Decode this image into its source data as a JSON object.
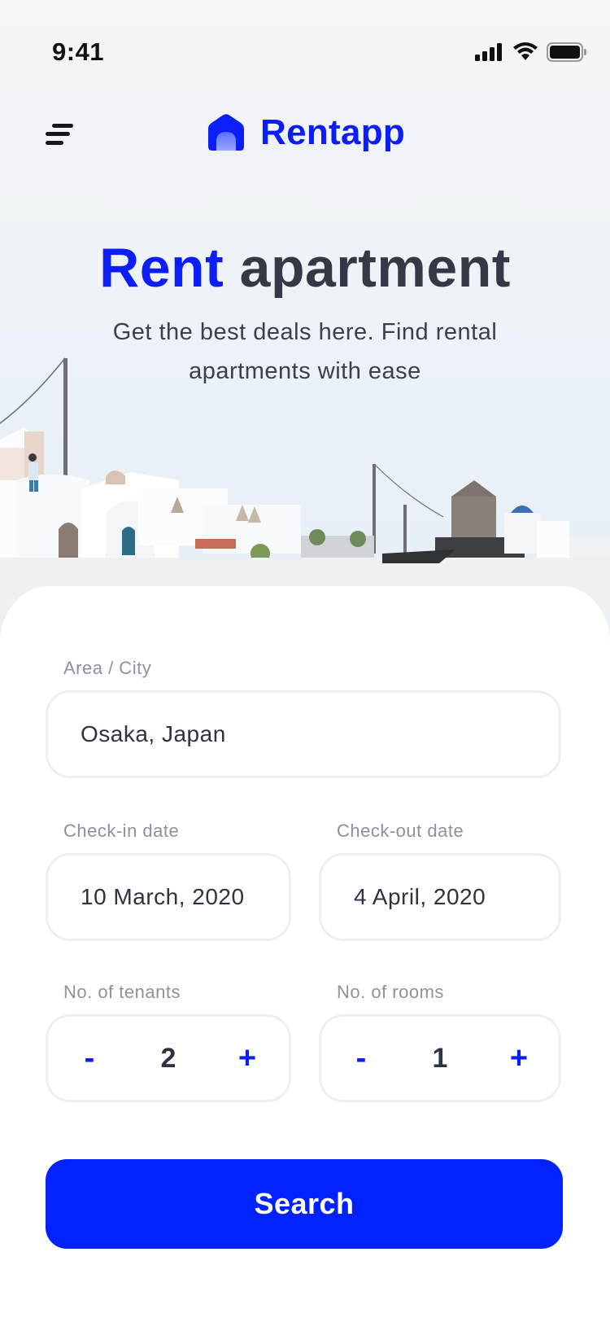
{
  "status_bar": {
    "time": "9:41"
  },
  "header": {
    "app_name": "Rentapp",
    "menu_icon": "menu-icon",
    "logo_icon": "house-icon"
  },
  "hero": {
    "title_accent": "Rent",
    "title_rest": "apartment",
    "subtitle": "Get the best deals here. Find rental apartments with ease"
  },
  "form": {
    "area": {
      "label": "Area / City",
      "value": "Osaka, Japan"
    },
    "check_in": {
      "label": "Check-in date",
      "value": "10 March, 2020"
    },
    "check_out": {
      "label": "Check-out date",
      "value": "4 April, 2020"
    },
    "tenants": {
      "label": "No. of tenants",
      "value": "2",
      "decrement": "-",
      "increment": "+"
    },
    "rooms": {
      "label": "No. of rooms",
      "value": "1",
      "decrement": "-",
      "increment": "+"
    },
    "search_label": "Search"
  },
  "colors": {
    "accent": "#0a1ef5",
    "button": "#0022ff",
    "text_dark": "#363848",
    "label_gray": "#8d91a0",
    "border": "#eceef2"
  }
}
